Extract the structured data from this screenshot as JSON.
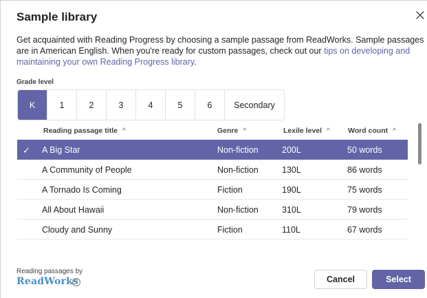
{
  "dialog": {
    "title": "Sample library",
    "close_icon": "close-icon"
  },
  "intro": {
    "text": "Get acquainted with Reading Progress by choosing a sample passage from ReadWorks. Sample passages are in American English. When you're ready for custom passages, check out our ",
    "link": "tips on developing and maintaining your own Reading Progress library",
    "tail": "."
  },
  "grade": {
    "label": "Grade level",
    "options": [
      "K",
      "1",
      "2",
      "3",
      "4",
      "5",
      "6",
      "Secondary"
    ],
    "selected": "K"
  },
  "table": {
    "headers": [
      "Reading passage title",
      "Genre",
      "Lexile level",
      "Word count"
    ],
    "sort_icon": "chevron-up-icon",
    "rows": [
      {
        "title": "A Big Star",
        "genre": "Non-fiction",
        "lexile": "200L",
        "words": "50 words",
        "selected": true
      },
      {
        "title": "A Community of People",
        "genre": "Non-fiction",
        "lexile": "130L",
        "words": "86 words",
        "selected": false
      },
      {
        "title": "A Tornado Is Coming",
        "genre": "Fiction",
        "lexile": "190L",
        "words": "75 words",
        "selected": false
      },
      {
        "title": "All About Hawaii",
        "genre": "Non-fiction",
        "lexile": "310L",
        "words": "79 words",
        "selected": false
      },
      {
        "title": "Cloudy and Sunny",
        "genre": "Fiction",
        "lexile": "110L",
        "words": "67 words",
        "selected": false
      }
    ]
  },
  "footer": {
    "credit": "Reading passages by",
    "brand": "ReadWorks",
    "cancel": "Cancel",
    "select": "Select"
  },
  "colors": {
    "accent": "#6264a7",
    "brand": "#4a8fc3"
  }
}
